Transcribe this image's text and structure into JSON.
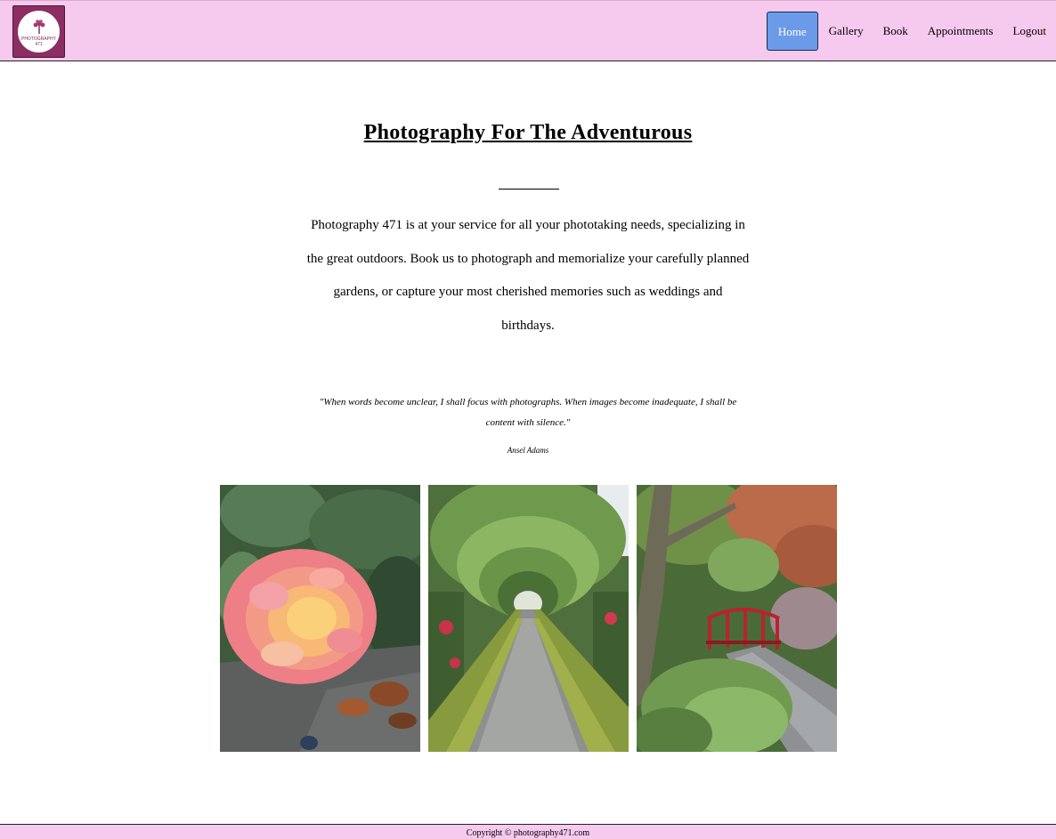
{
  "brand": {
    "logo_text": "PHOTOGRAPHY 471",
    "color": "#8c2d63"
  },
  "nav": {
    "items": [
      {
        "label": "Home",
        "active": true
      },
      {
        "label": "Gallery",
        "active": false
      },
      {
        "label": "Book",
        "active": false
      },
      {
        "label": "Appointments",
        "active": false
      },
      {
        "label": "Logout",
        "active": false
      }
    ],
    "active_color": "#6b9be8",
    "bar_color": "#f6c9ee"
  },
  "main": {
    "title": "Photography For The Adventurous",
    "intro": "Photography 471 is at your service for all your phototaking needs, specializing in the great outdoors. Book us to photograph and memorialize your carefully planned gardens, or capture your most cherished memories such as weddings and birthdays.",
    "quote": "\"When words become unclear, I shall focus with photographs. When images become inadequate, I shall be content with silence.\"",
    "quote_author": "Ansel Adams"
  },
  "gallery": {
    "photos": [
      {
        "subject": "pink-rose-photo"
      },
      {
        "subject": "garden-arch-path-photo"
      },
      {
        "subject": "red-bridge-garden-photo"
      }
    ]
  },
  "footer": {
    "copyright": "Copyright © photography471.com"
  }
}
